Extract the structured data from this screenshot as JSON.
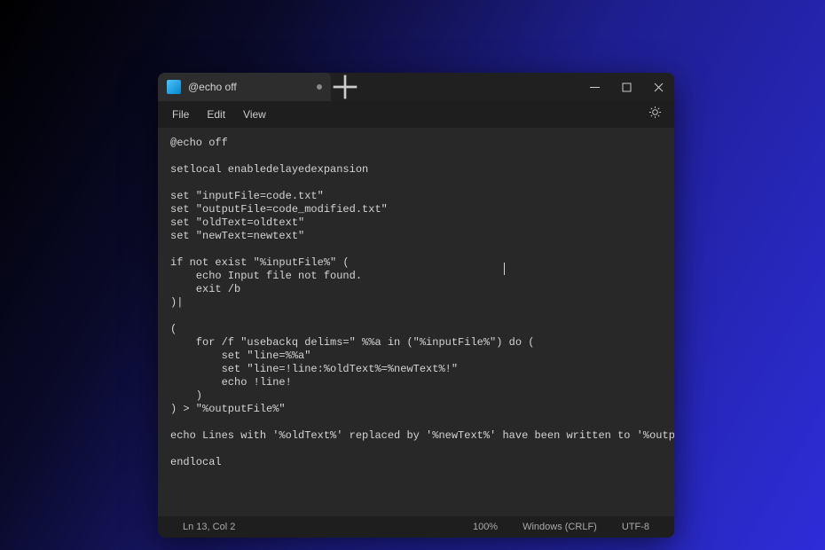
{
  "window": {
    "tab": {
      "title": "@echo off"
    },
    "menubar": {
      "file": "File",
      "edit": "Edit",
      "view": "View"
    },
    "editor": {
      "lines": [
        "@echo off",
        "",
        "setlocal enabledelayedexpansion",
        "",
        "set \"inputFile=code.txt\"",
        "set \"outputFile=code_modified.txt\"",
        "set \"oldText=oldtext\"",
        "set \"newText=newtext\"",
        "",
        "if not exist \"%inputFile%\" (",
        "    echo Input file not found.",
        "    exit /b",
        ")|",
        "",
        "(",
        "    for /f \"usebackq delims=\" %%a in (\"%inputFile%\") do (",
        "        set \"line=%%a\"",
        "        set \"line=!line:%oldText%=%newText%!\"",
        "        echo !line!",
        "    )",
        ") > \"%outputFile%\"",
        "",
        "echo Lines with '%oldText%' replaced by '%newText%' have been written to '%outputFile%'.",
        "",
        "endlocal"
      ]
    },
    "statusbar": {
      "position": "Ln 13, Col 2",
      "zoom": "100%",
      "lineending": "Windows (CRLF)",
      "encoding": "UTF-8"
    }
  }
}
